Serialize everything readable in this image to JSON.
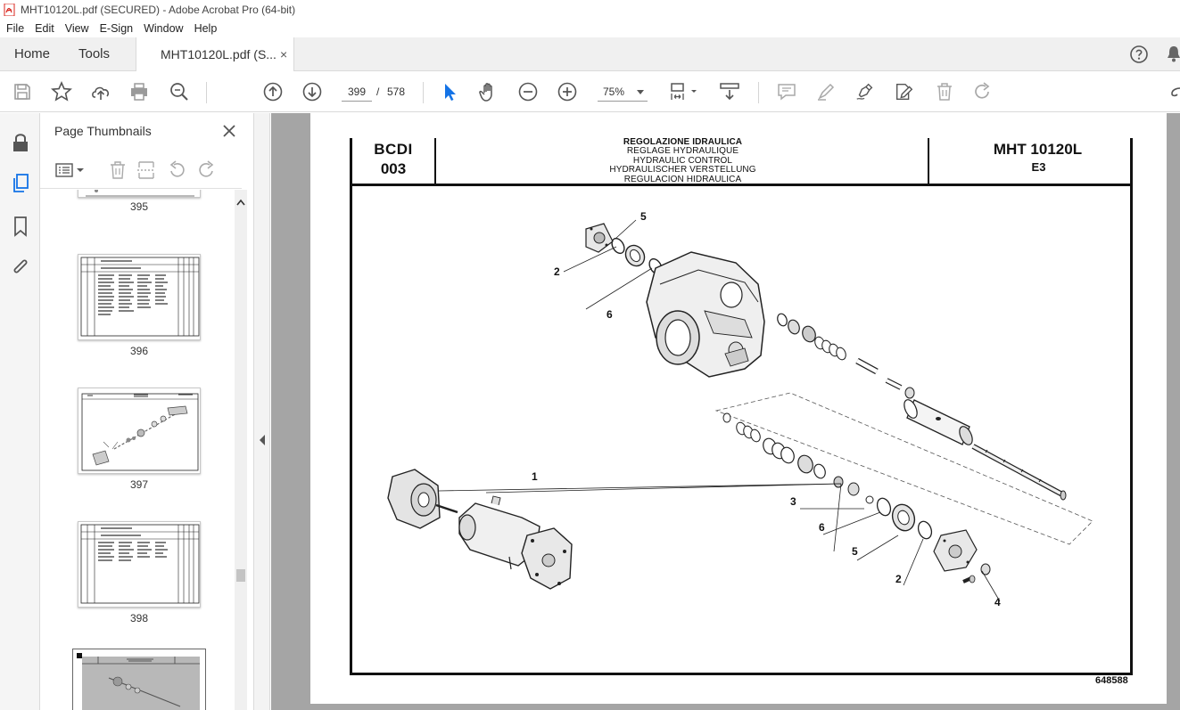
{
  "window": {
    "title": "MHT10120L.pdf (SECURED) - Adobe Acrobat Pro (64-bit)"
  },
  "menu": [
    "File",
    "Edit",
    "View",
    "E-Sign",
    "Window",
    "Help"
  ],
  "tabs": {
    "home": "Home",
    "tools": "Tools",
    "document": "MHT10120L.pdf (S...",
    "document_close": "×"
  },
  "toolbar": {
    "current_page": "399",
    "page_separator": "/",
    "total_pages": "578",
    "zoom": "75%"
  },
  "thumbnails_panel": {
    "title": "Page Thumbnails",
    "pages": [
      "395",
      "396",
      "397",
      "398"
    ]
  },
  "document_page": {
    "header_left_line1": "BCDI",
    "header_left_line2": "003",
    "header_titles": [
      "REGOLAZIONE IDRAULICA",
      "REGLAGE HYDRAULIQUE",
      "HYDRAULIC CONTROL",
      "HYDRAULISCHER VERSTELLUNG",
      "REGULACION HIDRAULICA"
    ],
    "header_right_line1": "MHT 10120L",
    "header_right_line2": "E3",
    "callouts": [
      "5",
      "2",
      "6",
      "1",
      "3",
      "6",
      "5",
      "2",
      "4"
    ],
    "drawing_code": "648588"
  },
  "colors": {
    "accent_blue": "#1473e6",
    "doc_background": "#a5a5a5",
    "pdf_icon_red": "#d9251c"
  }
}
